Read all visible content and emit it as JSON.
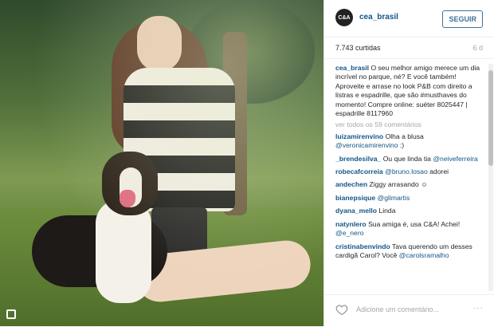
{
  "post": {
    "username": "cea_brasil",
    "avatar_text": "C&A",
    "follow_label": "SEGUIR",
    "likes": "7.743 curtidas",
    "age": "6 d"
  },
  "caption": {
    "handle": "cea_brasil",
    "text": "O seu melhor amigo merece um dia incrível no parque, né? E você também! Aproveite e arrase no look P&B com direito a listras e espadrille, que são #musthaves do momento!",
    "text2": "Compre online: suéter 8025447 | espadrille 8117960"
  },
  "view_all": "ver todos os 59 comentários",
  "comments": [
    {
      "user": "luizamirenvino",
      "text": "Olha a blusa",
      "mention": "@veronicamirenvino",
      "tail": ":)"
    },
    {
      "user": "_brendesilva_",
      "text": "Ou que linda tia",
      "mention": "@neiveferreira",
      "tail": ""
    },
    {
      "user": "robecafcorreia",
      "text": "",
      "mention": "@bruno.losao",
      "tail": "adorei"
    },
    {
      "user": "andechen",
      "text": "Ziggy arrasando ☺",
      "mention": "",
      "tail": ""
    },
    {
      "user": "bianepsique",
      "text": "",
      "mention": "@glimartis",
      "tail": ""
    },
    {
      "user": "dyana_mello",
      "text": "Linda",
      "mention": "",
      "tail": ""
    },
    {
      "user": "natynlero",
      "text": "Sua amiga é, usa C&A! Achei!",
      "mention": "@e_nero",
      "tail": ""
    },
    {
      "user": "cristinabenvindo",
      "text": "Tava querendo um desses cardigã Carol? Você",
      "mention": "@carolsramalho",
      "tail": ""
    }
  ],
  "footer": {
    "add_comment_placeholder": "Adicione um comentário...",
    "more_label": "···"
  },
  "icons": {
    "heart": "heart-icon",
    "corner": "instagram-icon"
  }
}
